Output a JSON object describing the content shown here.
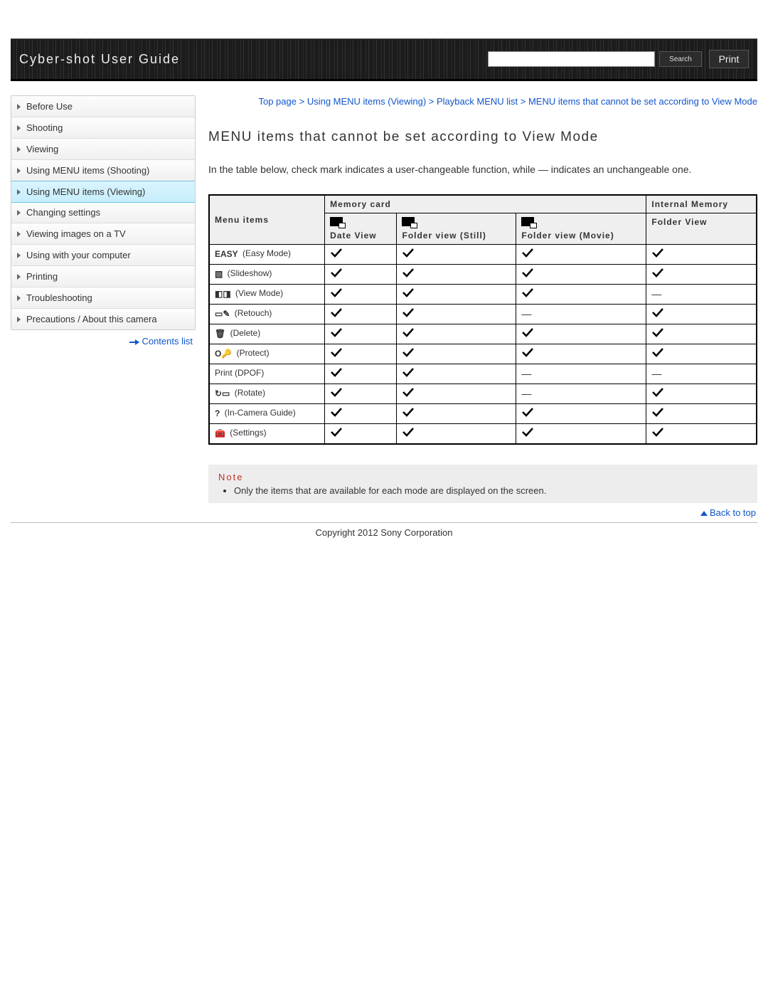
{
  "header": {
    "title": "Cyber-shot User Guide",
    "search_button": "Search",
    "print_button": "Print"
  },
  "sidebar": {
    "items": [
      {
        "label": "Before Use"
      },
      {
        "label": "Shooting"
      },
      {
        "label": "Viewing"
      },
      {
        "label": "Using MENU items (Shooting)"
      },
      {
        "label": "Using MENU items (Viewing)",
        "active": true
      },
      {
        "label": "Changing settings"
      },
      {
        "label": "Viewing images on a TV"
      },
      {
        "label": "Using with your computer"
      },
      {
        "label": "Printing"
      },
      {
        "label": "Troubleshooting"
      },
      {
        "label": "Precautions / About this camera"
      }
    ],
    "contents_link": "Contents list"
  },
  "breadcrumbs": {
    "parts": [
      "Top page",
      "Using MENU items (Viewing)",
      "Playback MENU list",
      "MENU items that cannot be set according to View Mode"
    ],
    "sep": " > "
  },
  "main": {
    "title": "MENU items that cannot be set according to View Mode",
    "intro": "In the table below, check mark indicates a user-changeable function, while — indicates an unchangeable one."
  },
  "table": {
    "head": {
      "menu_items": "Menu items",
      "memory_card": "Memory card",
      "internal_memory": "Internal Memory",
      "date_view": "Date View",
      "folder_still": "Folder view (Still)",
      "folder_movie": "Folder view (Movie)",
      "folder_view": "Folder View"
    },
    "rows": [
      {
        "icon": "EASY",
        "icon_text": "EASY",
        "label": " (Easy Mode)",
        "c": [
          "y",
          "y",
          "y",
          "y"
        ]
      },
      {
        "icon": "slideshow",
        "icon_text": "▧",
        "label": " (Slideshow)",
        "c": [
          "y",
          "y",
          "y",
          "y"
        ]
      },
      {
        "icon": "viewmode",
        "icon_text": "◧◨",
        "label": " (View Mode)",
        "c": [
          "y",
          "y",
          "y",
          "n"
        ]
      },
      {
        "icon": "retouch",
        "icon_text": "▭✎",
        "label": " (Retouch)",
        "c": [
          "y",
          "y",
          "n",
          "y"
        ]
      },
      {
        "icon": "delete",
        "icon_text": "🗑",
        "label": " (Delete)",
        "c": [
          "y",
          "y",
          "y",
          "y"
        ]
      },
      {
        "icon": "protect",
        "icon_text": "O🔑",
        "label": " (Protect)",
        "c": [
          "y",
          "y",
          "y",
          "y"
        ]
      },
      {
        "icon": "",
        "icon_text": "",
        "label": "Print (DPOF)",
        "c": [
          "y",
          "y",
          "n",
          "n"
        ]
      },
      {
        "icon": "rotate",
        "icon_text": "↻▭",
        "label": " (Rotate)",
        "c": [
          "y",
          "y",
          "n",
          "y"
        ]
      },
      {
        "icon": "guide",
        "icon_text": "?",
        "label": " (In-Camera Guide)",
        "c": [
          "y",
          "y",
          "y",
          "y"
        ]
      },
      {
        "icon": "settings",
        "icon_text": "🧰",
        "label": " (Settings)",
        "c": [
          "y",
          "y",
          "y",
          "y"
        ]
      }
    ]
  },
  "note": {
    "title": "Note",
    "text": "Only the items that are available for each mode are displayed on the screen."
  },
  "back_to_top": "Back to top",
  "copyright": "Copyright 2012 Sony Corporation"
}
